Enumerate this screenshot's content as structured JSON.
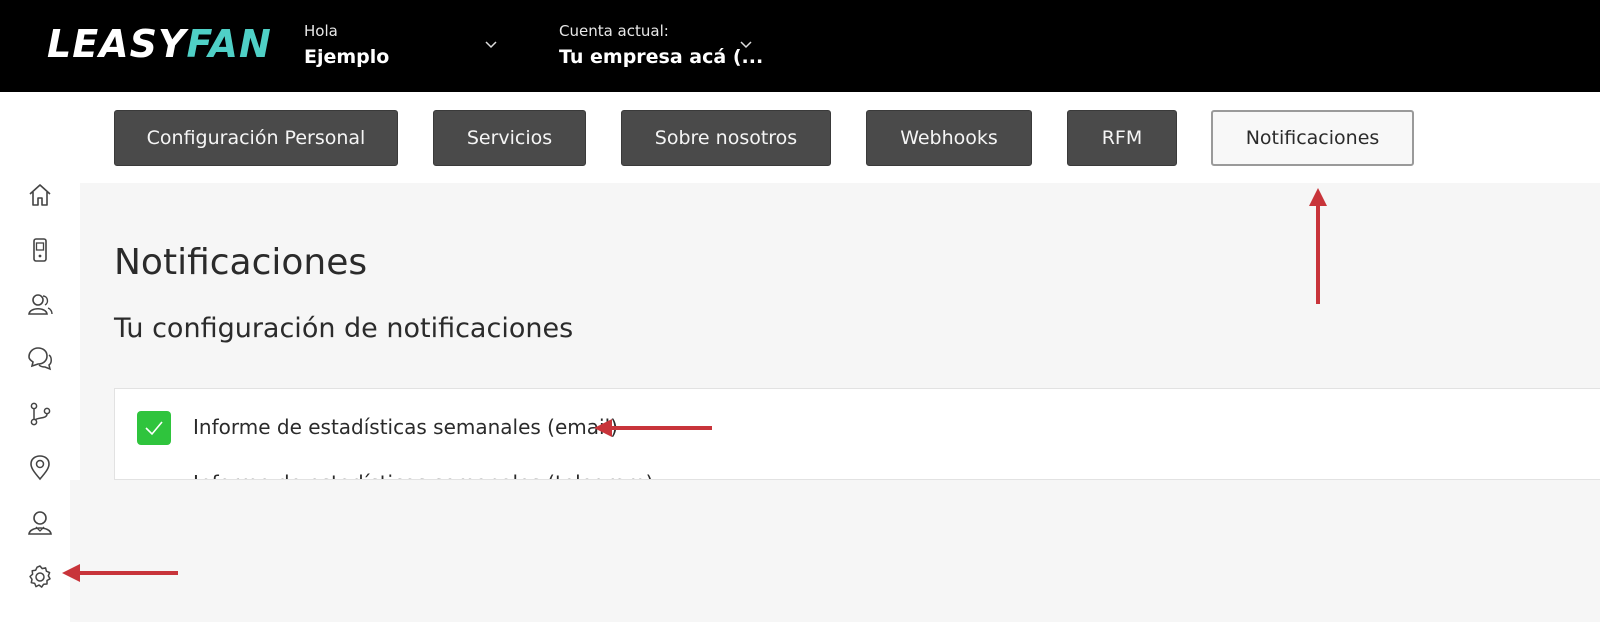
{
  "header": {
    "logo_part1": "LEASY",
    "logo_part2": "FAN",
    "greeting_label": "Hola",
    "user_name": "Ejemplo",
    "account_label": "Cuenta actual:",
    "account_value": "Tu empresa acá (..."
  },
  "tabs": [
    {
      "label": "Configuración Personal"
    },
    {
      "label": "Servicios"
    },
    {
      "label": "Sobre nosotros"
    },
    {
      "label": "Webhooks"
    },
    {
      "label": "RFM"
    },
    {
      "label": "Notificaciones",
      "active": true
    }
  ],
  "sidebar": {
    "icons": [
      "home-icon",
      "device-icon",
      "contacts-icon",
      "chat-icon",
      "flow-icon",
      "location-icon",
      "user-icon",
      "settings-icon"
    ]
  },
  "page": {
    "title": "Notificaciones",
    "section_title": "Tu configuración de notificaciones",
    "options": [
      {
        "label": "Informe de estadísticas semanales (email)",
        "checked": true
      },
      {
        "label": "Informe de estadísticas semanales (telegram)",
        "checked": false
      }
    ]
  },
  "colors": {
    "header_bg": "#000000",
    "logo_accent": "#4fd0c6",
    "tab_bg": "#4a4a4a",
    "check_green": "#2fc43d",
    "annotation_red": "#c8343a"
  }
}
